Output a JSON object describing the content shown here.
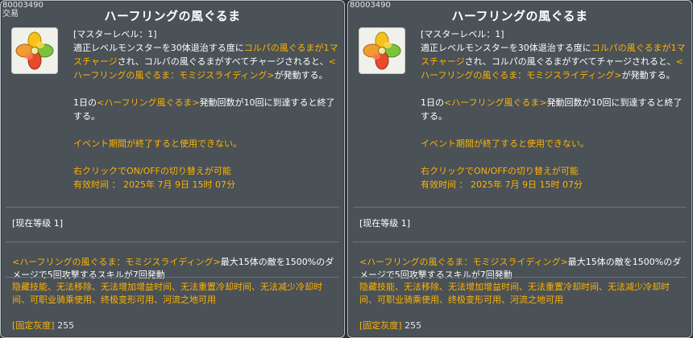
{
  "tooltips": [
    {
      "item_id": "80003490",
      "note": "交易",
      "title": "ハーフリングの風ぐるま",
      "desc_line1": "[マスターレベル：1]",
      "desc_line2_pre": "適正レベルモンスターを30体退治する度に",
      "desc_line2_hl": "コルパの風ぐるまが1マスチャージ",
      "desc_line2_post": "され、コルパの風ぐるまがすべてチャージされると、",
      "desc_line2_hl2": "<ハーフリングの風ぐるま：モミジスライディング>",
      "desc_line2_end": "が発動する。",
      "desc_limit_pre": "1日の",
      "desc_limit_hl": "<ハーフリング風ぐるま>",
      "desc_limit_post": "発動回数が10回に到達すると終了する。",
      "desc_event": "イベント期間が終了すると使用できない。",
      "desc_toggle": "右クリックでON/OFFの切り替えが可能",
      "desc_expiry": "有效时间 ： 2025年 7月 9日 15时 07分",
      "level": "[现在等级 1]",
      "skill_hl": "<ハーフリングの風ぐるま：モミジスライディング>",
      "skill_text": "最大15体の敵を1500%のダメージで5回攻撃するスキルが7回発動",
      "flags": "隐藏技能、无法移除、无法增加增益时间、无法重置冷却时间、无法减少冷却时间、可职业骑乘使用、终极变形可用、河流之地可用",
      "fixed_label": "[固定灰度]",
      "fixed_value": "255"
    },
    {
      "item_id": "80003490",
      "note": "",
      "title": "ハーフリングの風ぐるま",
      "desc_line1": "[マスターレベル：1]",
      "desc_line2_pre": "適正レベルモンスターを30体退治する度に",
      "desc_line2_hl": "コルパの風ぐるまが1マスチャージ",
      "desc_line2_post": "され、コルパの風ぐるまがすべてチャージされると、",
      "desc_line2_hl2": "<ハーフリングの風ぐるま：モミジスライディング>",
      "desc_line2_end": "が発動する。",
      "desc_limit_pre": "1日の",
      "desc_limit_hl": "<ハーフリング風ぐるま>",
      "desc_limit_post": "発動回数が10回に到達すると終了する。",
      "desc_event": "イベント期間が終了すると使用できない。",
      "desc_toggle": "右クリックでON/OFFの切り替えが可能",
      "desc_expiry": "有效时间 ： 2025年 7月 9日 15时 07分",
      "level": "[现在等级 1]",
      "skill_hl": "<ハーフリングの風ぐるま：モミジスライディング>",
      "skill_text": "最大15体の敵を1500%のダメージで5回攻撃するスキルが7回発動",
      "flags": "隐藏技能、无法移除、无法增加增益时间、无法重置冷却时间、无法减少冷却时间、可职业骑乘使用、终极变形可用、河流之地可用",
      "fixed_label": "[固定灰度]",
      "fixed_value": "255"
    }
  ],
  "colors": {
    "background": "#4a5157",
    "border": "#b9c0c5",
    "highlight": "#ffb300",
    "text": "#ffffff"
  },
  "icon": {
    "name": "pinwheel-icon"
  }
}
